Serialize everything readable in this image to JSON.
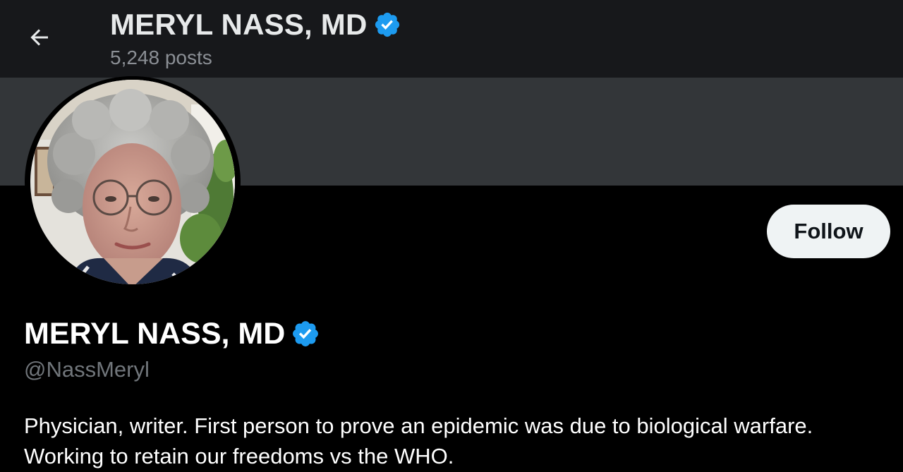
{
  "header": {
    "back_icon": "arrow-left-icon",
    "title": "MERYL NASS, MD",
    "post_count": "5,248 posts",
    "verified_icon": "verified-badge-icon"
  },
  "profile": {
    "avatar_icon": "profile-photo",
    "follow_label": "Follow",
    "name": "MERYL NASS, MD",
    "verified_icon": "verified-badge-icon",
    "handle": "@NassMeryl",
    "bio_lines": [
      "Physician, writer. First person to prove an epidemic was due to biological warfare.",
      "Working to retain our freedoms vs the WHO."
    ]
  },
  "colors": {
    "header_bg": "#17181b",
    "banner_bg": "#333639",
    "page_bg": "#000000",
    "verified_blue": "#1d9bf0",
    "follow_bg": "#eff3f4",
    "muted_text": "#71767b"
  }
}
